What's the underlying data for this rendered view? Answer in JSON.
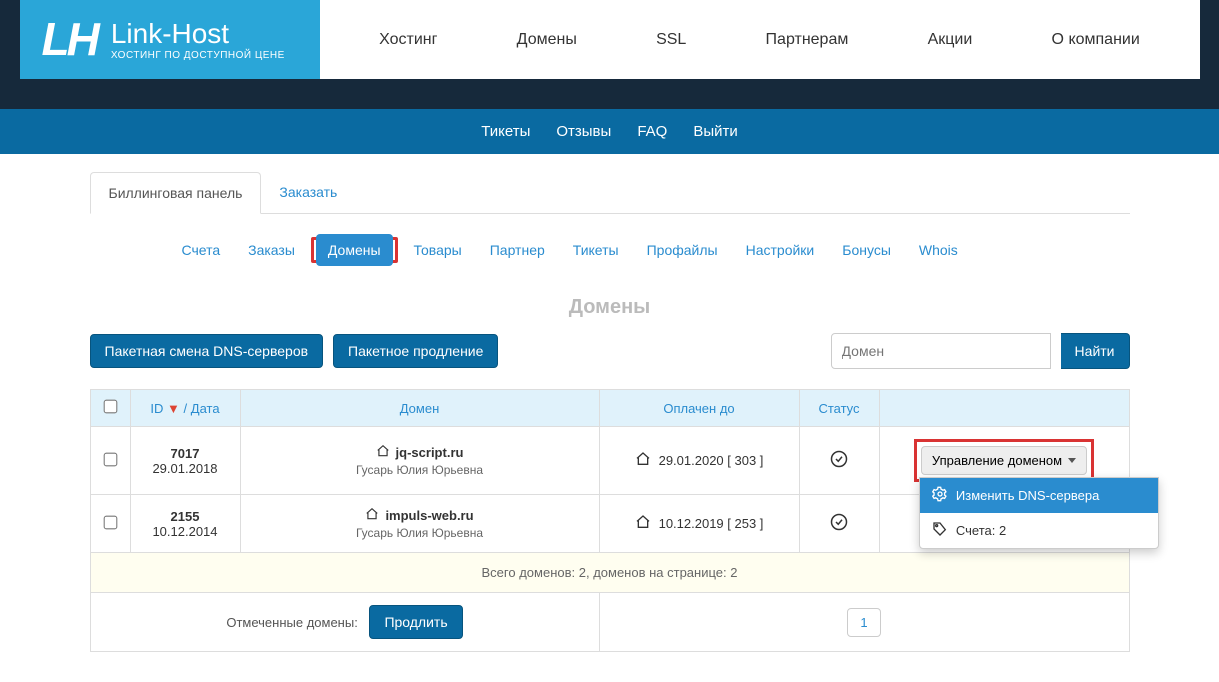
{
  "brand": {
    "title": "Link-Host",
    "subtitle": "ХОСТИНГ ПО ДОСТУПНОЙ ЦЕНЕ"
  },
  "main_nav": [
    "Хостинг",
    "Домены",
    "SSL",
    "Партнерам",
    "Акции",
    "О компании"
  ],
  "sub_nav": [
    "Тикеты",
    "Отзывы",
    "FAQ",
    "Выйти"
  ],
  "tabs_top": {
    "active": "Биллинговая панель",
    "other": "Заказать"
  },
  "billing_tabs": [
    "Счета",
    "Заказы",
    "Домены",
    "Товары",
    "Партнер",
    "Тикеты",
    "Профайлы",
    "Настройки",
    "Бонусы",
    "Whois"
  ],
  "billing_active": "Домены",
  "page_title": "Домены",
  "actions": {
    "bulk_dns": "Пакетная смена DNS-серверов",
    "bulk_renew": "Пакетное продление"
  },
  "search": {
    "placeholder": "Домен",
    "button": "Найти"
  },
  "table": {
    "headers": {
      "id_date": "ID",
      "date_lbl": " / Дата",
      "domain": "Домен",
      "paid_until": "Оплачен до",
      "status": "Статус"
    },
    "sort_indicator": "▼",
    "rows": [
      {
        "id": "7017",
        "date": "29.01.2018",
        "domain": "jq-script.ru",
        "owner": "Гусарь Юлия Юрьевна",
        "paid": "29.01.2020 [ 303 ]"
      },
      {
        "id": "2155",
        "date": "10.12.2014",
        "domain": "impuls-web.ru",
        "owner": "Гусарь Юлия Юрьевна",
        "paid": "10.12.2019 [ 253 ]"
      }
    ],
    "summary": "Всего доменов: 2, доменов на странице: 2",
    "footer_label": "Отмеченные домены:",
    "footer_btn": "Продлить",
    "page": "1"
  },
  "dropdown": {
    "toggle": "Управление доменом",
    "item_active": "Изменить DNS-сервера",
    "item_below": "Счета: 2"
  }
}
